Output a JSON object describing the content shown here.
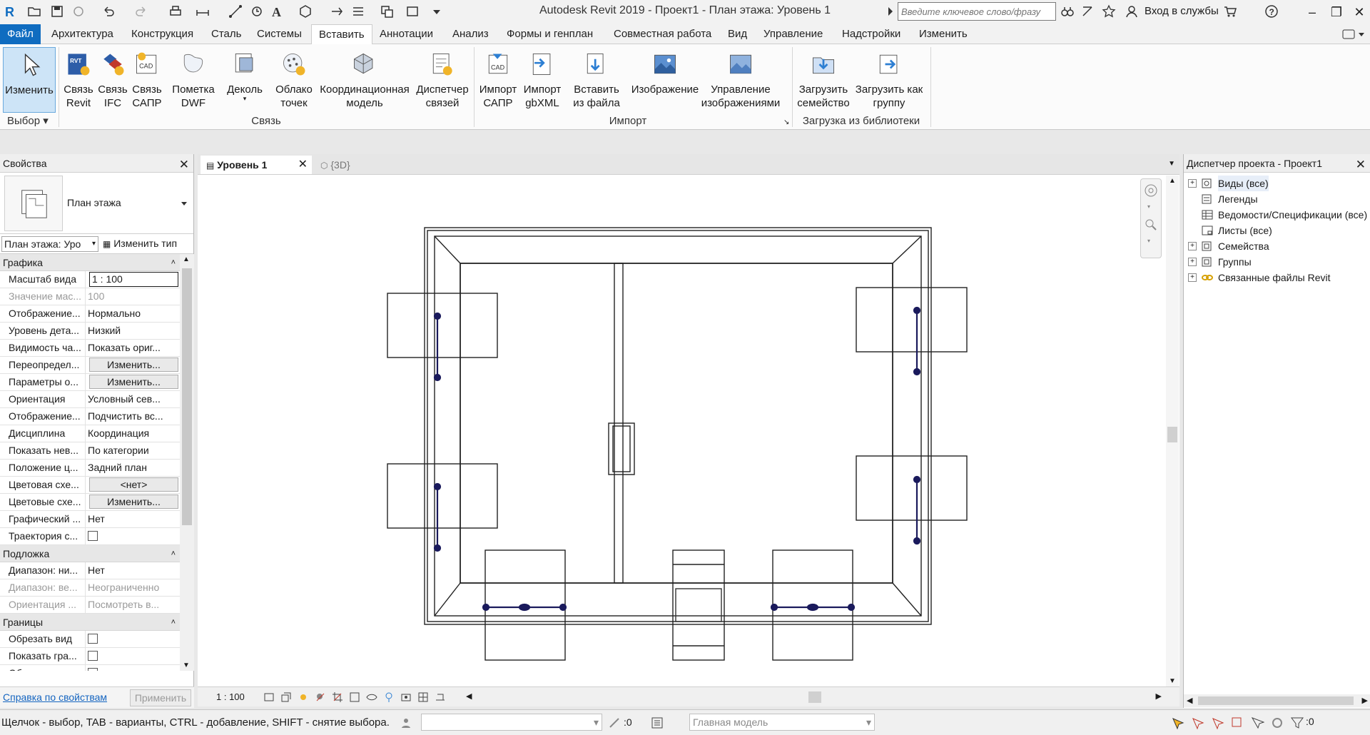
{
  "app": {
    "title": "Autodesk Revit 2019 - Проект1 - План этажа: Уровень 1",
    "search_placeholder": "Введите ключевое слово/фразу",
    "signin": "Вход в службы",
    "accent": "#0f6cc0"
  },
  "ribbon_tabs": [
    "Файл",
    "Архитектура",
    "Конструкция",
    "Сталь",
    "Системы",
    "Вставить",
    "Аннотации",
    "Анализ",
    "Формы и генплан",
    "Совместная работа",
    "Вид",
    "Управление",
    "Надстройки",
    "Изменить"
  ],
  "ribbon": {
    "modify": "Изменить",
    "select_panel": "Выбор",
    "link_revit": "Связь\nRevit",
    "link_ifc": "Связь\nIFC",
    "link_cad": "Связь\nСАПР",
    "markup_dwf": "Пометка\nDWF",
    "decal": "Деколь",
    "point_cloud": "Облако\nточек",
    "coord_model": "Координационная\nмодель",
    "manage_links": "Диспетчер\nсвязей",
    "link_panel": "Связь",
    "import_cad": "Импорт\nСАПР",
    "import_gbxml": "Импорт\ngbXML",
    "insert_from_file": "Вставить\nиз файла",
    "image": "Изображение",
    "manage_images": "Управление\nизображениями",
    "import_panel": "Импорт",
    "load_family": "Загрузить\nсемейство",
    "load_group": "Загрузить как\nгруппу",
    "library_panel": "Загрузка из библиотеки"
  },
  "properties": {
    "title": "Свойства",
    "type_name": "План этажа",
    "instance_selector": "План этажа: Уро",
    "edit_type": "Изменить тип",
    "groups": [
      {
        "name": "Графика",
        "rows": [
          {
            "name": "Масштаб вида",
            "value": "1 : 100",
            "kind": "input"
          },
          {
            "name": "Значение мас...",
            "value": "100",
            "kind": "disabled"
          },
          {
            "name": "Отображение...",
            "value": "Нормально"
          },
          {
            "name": "Уровень дета...",
            "value": "Низкий"
          },
          {
            "name": "Видимость ча...",
            "value": "Показать ориг..."
          },
          {
            "name": "Переопредел...",
            "value": "Изменить...",
            "kind": "button"
          },
          {
            "name": "Параметры о...",
            "value": "Изменить...",
            "kind": "button"
          },
          {
            "name": "Ориентация",
            "value": "Условный сев..."
          },
          {
            "name": "Отображение...",
            "value": "Подчистить вс..."
          },
          {
            "name": "Дисциплина",
            "value": "Координация"
          },
          {
            "name": "Показать нев...",
            "value": "По категории"
          },
          {
            "name": "Положение ц...",
            "value": "Задний план"
          },
          {
            "name": "Цветовая схе...",
            "value": "<нет>",
            "kind": "button"
          },
          {
            "name": "Цветовые схе...",
            "value": "Изменить...",
            "kind": "button"
          },
          {
            "name": "Графический ...",
            "value": "Нет"
          },
          {
            "name": "Траектория с...",
            "value": "",
            "kind": "checkbox"
          }
        ]
      },
      {
        "name": "Подложка",
        "rows": [
          {
            "name": "Диапазон: ни...",
            "value": "Нет"
          },
          {
            "name": "Диапазон: ве...",
            "value": "Неограниченно",
            "kind": "disabled"
          },
          {
            "name": "Ориентация ...",
            "value": "Посмотреть в...",
            "kind": "disabled"
          }
        ]
      },
      {
        "name": "Границы",
        "rows": [
          {
            "name": "Обрезать вид",
            "value": "",
            "kind": "checkbox"
          },
          {
            "name": "Показать гра...",
            "value": "",
            "kind": "checkbox"
          },
          {
            "name": "Обрезать анн...",
            "value": "",
            "kind": "checkbox"
          }
        ]
      }
    ],
    "help_link": "Справка по свойствам",
    "apply": "Применить"
  },
  "view_tabs": [
    {
      "label": "Уровень 1",
      "active": true
    },
    {
      "label": "{3D}",
      "active": false
    }
  ],
  "view_scale": "1 : 100",
  "project_browser": {
    "title": "Диспетчер проекта - Проект1",
    "nodes": [
      {
        "label": "Виды (все)",
        "expandable": true,
        "icon": "views-icon",
        "selected": true
      },
      {
        "label": "Легенды",
        "expandable": false,
        "icon": "legends-icon"
      },
      {
        "label": "Ведомости/Спецификации (все)",
        "expandable": false,
        "icon": "schedules-icon"
      },
      {
        "label": "Листы (все)",
        "expandable": false,
        "icon": "sheets-icon"
      },
      {
        "label": "Семейства",
        "expandable": true,
        "icon": "families-icon"
      },
      {
        "label": "Группы",
        "expandable": true,
        "icon": "groups-icon"
      },
      {
        "label": "Связанные файлы Revit",
        "expandable": true,
        "icon": "links-icon"
      }
    ]
  },
  "status": {
    "hint": "Щелчок - выбор, TAB - варианты, CTRL - добавление, SHIFT - снятие выбора.",
    "selection_count": ":0",
    "model": "Главная модель",
    "filter_count": ":0"
  }
}
